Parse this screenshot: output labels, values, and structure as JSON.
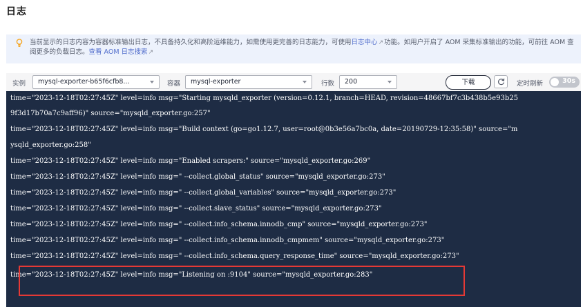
{
  "page": {
    "title": "日志"
  },
  "notice": {
    "text_before": "当前显示的日志内容为容器标准输出日志，不具备持久化和高阶运维能力，如需使用更完善的日志能力，可使用",
    "link1": "日志中心",
    "text_mid": "功能。如用户开启了 AOM 采集标准输出的功能，可前往 AOM 查阅更多的负载日志。",
    "link2": "查看 AOM 日志搜索"
  },
  "toolbar": {
    "instance_label": "实例",
    "instance_value": "mysql-exporter-b65f6cfb8...",
    "container_label": "容器",
    "container_value": "mysql-exporter",
    "rows_label": "行数",
    "rows_value": "200",
    "download_label": "下载",
    "auto_refresh_label": "定时刷新",
    "auto_refresh_interval": "30s"
  },
  "logs": [
    "time=\"2023-12-18T02:27:45Z\" level=info msg=\"Starting mysqld_exporter (version=0.12.1, branch=HEAD, revision=48667bf7c3b438b5e93b25",
    "9f3d17b70a7c9aff96)\" source=\"mysqld_exporter.go:257\"",
    "time=\"2023-12-18T02:27:45Z\" level=info msg=\"Build context (go=go1.12.7, user=root@0b3e56a7bc0a, date=20190729-12:35:58)\" source=\"m",
    "ysqld_exporter.go:258\"",
    "time=\"2023-12-18T02:27:45Z\" level=info msg=\"Enabled scrapers:\" source=\"mysqld_exporter.go:269\"",
    "time=\"2023-12-18T02:27:45Z\" level=info msg=\" --collect.global_status\" source=\"mysqld_exporter.go:273\"",
    "time=\"2023-12-18T02:27:45Z\" level=info msg=\" --collect.global_variables\" source=\"mysqld_exporter.go:273\"",
    "time=\"2023-12-18T02:27:45Z\" level=info msg=\" --collect.slave_status\" source=\"mysqld_exporter.go:273\"",
    "time=\"2023-12-18T02:27:45Z\" level=info msg=\" --collect.info_schema.innodb_cmp\" source=\"mysqld_exporter.go:273\"",
    "time=\"2023-12-18T02:27:45Z\" level=info msg=\" --collect.info_schema.innodb_cmpmem\" source=\"mysqld_exporter.go:273\"",
    "time=\"2023-12-18T02:27:45Z\" level=info msg=\" --collect.info_schema.query_response_time\" source=\"mysqld_exporter.go:273\"",
    "time=\"2023-12-18T02:27:45Z\" level=info msg=\"Listening on :9104\" source=\"mysqld_exporter.go:283\""
  ],
  "colors": {
    "console_bg": "#1e2c44",
    "highlight": "#e53935",
    "link": "#526ecc"
  }
}
